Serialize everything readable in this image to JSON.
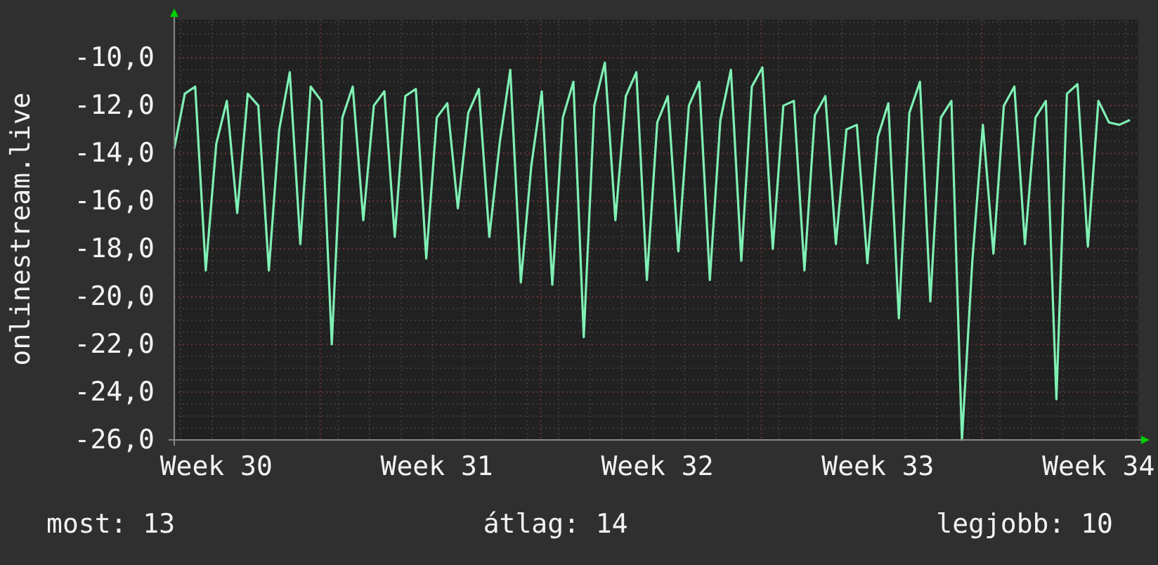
{
  "chart": {
    "chart_data": {
      "type": "line",
      "ylabel": "onlinestream.live",
      "categories": [
        null,
        null,
        null,
        null,
        "Week 30",
        null,
        null,
        null,
        null,
        null,
        null,
        null,
        null,
        null,
        null,
        null,
        null,
        null,
        null,
        null,
        null,
        null,
        null,
        null,
        null,
        "Week 31",
        null,
        null,
        null,
        null,
        null,
        null,
        null,
        null,
        null,
        null,
        null,
        null,
        null,
        null,
        null,
        null,
        null,
        null,
        null,
        null,
        "Week 32",
        null,
        null,
        null,
        null,
        null,
        null,
        null,
        null,
        null,
        null,
        null,
        null,
        null,
        null,
        null,
        null,
        null,
        null,
        null,
        null,
        "Week 33",
        null,
        null,
        null,
        null,
        null,
        null,
        null,
        null,
        null,
        null,
        null,
        null,
        null,
        null,
        null,
        null,
        null,
        null,
        null,
        null,
        "Week 34",
        null,
        null,
        null
      ],
      "series": [
        {
          "color": "#7ff0b4",
          "values": [
            -13.8,
            -11.5,
            -11.2,
            -18.9,
            -13.6,
            -11.8,
            -16.5,
            -11.5,
            -12.0,
            -18.9,
            -13.0,
            -10.6,
            -17.8,
            -11.2,
            -11.8,
            -22.0,
            -12.5,
            -11.2,
            -16.8,
            -12.0,
            -11.4,
            -17.5,
            -11.6,
            -11.3,
            -18.4,
            -12.5,
            -11.9,
            -16.3,
            -12.3,
            -11.3,
            -17.5,
            -13.5,
            -10.5,
            -19.4,
            -14.5,
            -11.4,
            -19.5,
            -12.5,
            -11.0,
            -21.7,
            -12.0,
            -10.2,
            -16.8,
            -11.6,
            -10.6,
            -19.3,
            -12.7,
            -11.6,
            -18.1,
            -12.0,
            -11.0,
            -19.3,
            -12.6,
            -10.5,
            -18.5,
            -11.2,
            -10.4,
            -18.0,
            -12.0,
            -11.8,
            -18.9,
            -12.4,
            -11.6,
            -17.8,
            -13.0,
            -12.8,
            -18.6,
            -13.3,
            -11.9,
            -20.9,
            -12.3,
            -11.0,
            -20.2,
            -12.5,
            -11.8,
            -26.0,
            -18.5,
            -12.8,
            -18.2,
            -12.0,
            -11.2,
            -17.8,
            -12.5,
            -11.8,
            -24.3,
            -11.5,
            -11.1,
            -17.9,
            -11.8,
            -12.7,
            -12.8,
            -12.6
          ]
        }
      ],
      "ylim": [
        -26,
        -8.4
      ],
      "grid": true,
      "yticks": [
        {
          "value": -10,
          "label": "-10,0"
        },
        {
          "value": -12,
          "label": "-12,0"
        },
        {
          "value": -14,
          "label": "-14,0"
        },
        {
          "value": -16,
          "label": "-16,0"
        },
        {
          "value": -18,
          "label": "-18,0"
        },
        {
          "value": -20,
          "label": "-20,0"
        },
        {
          "value": -22,
          "label": "-22,0"
        },
        {
          "value": -24,
          "label": "-24,0"
        },
        {
          "value": -26,
          "label": "-26,0"
        }
      ]
    }
  },
  "legend": [
    "most: 13",
    "átlag: 14",
    "legjobb: 10"
  ]
}
